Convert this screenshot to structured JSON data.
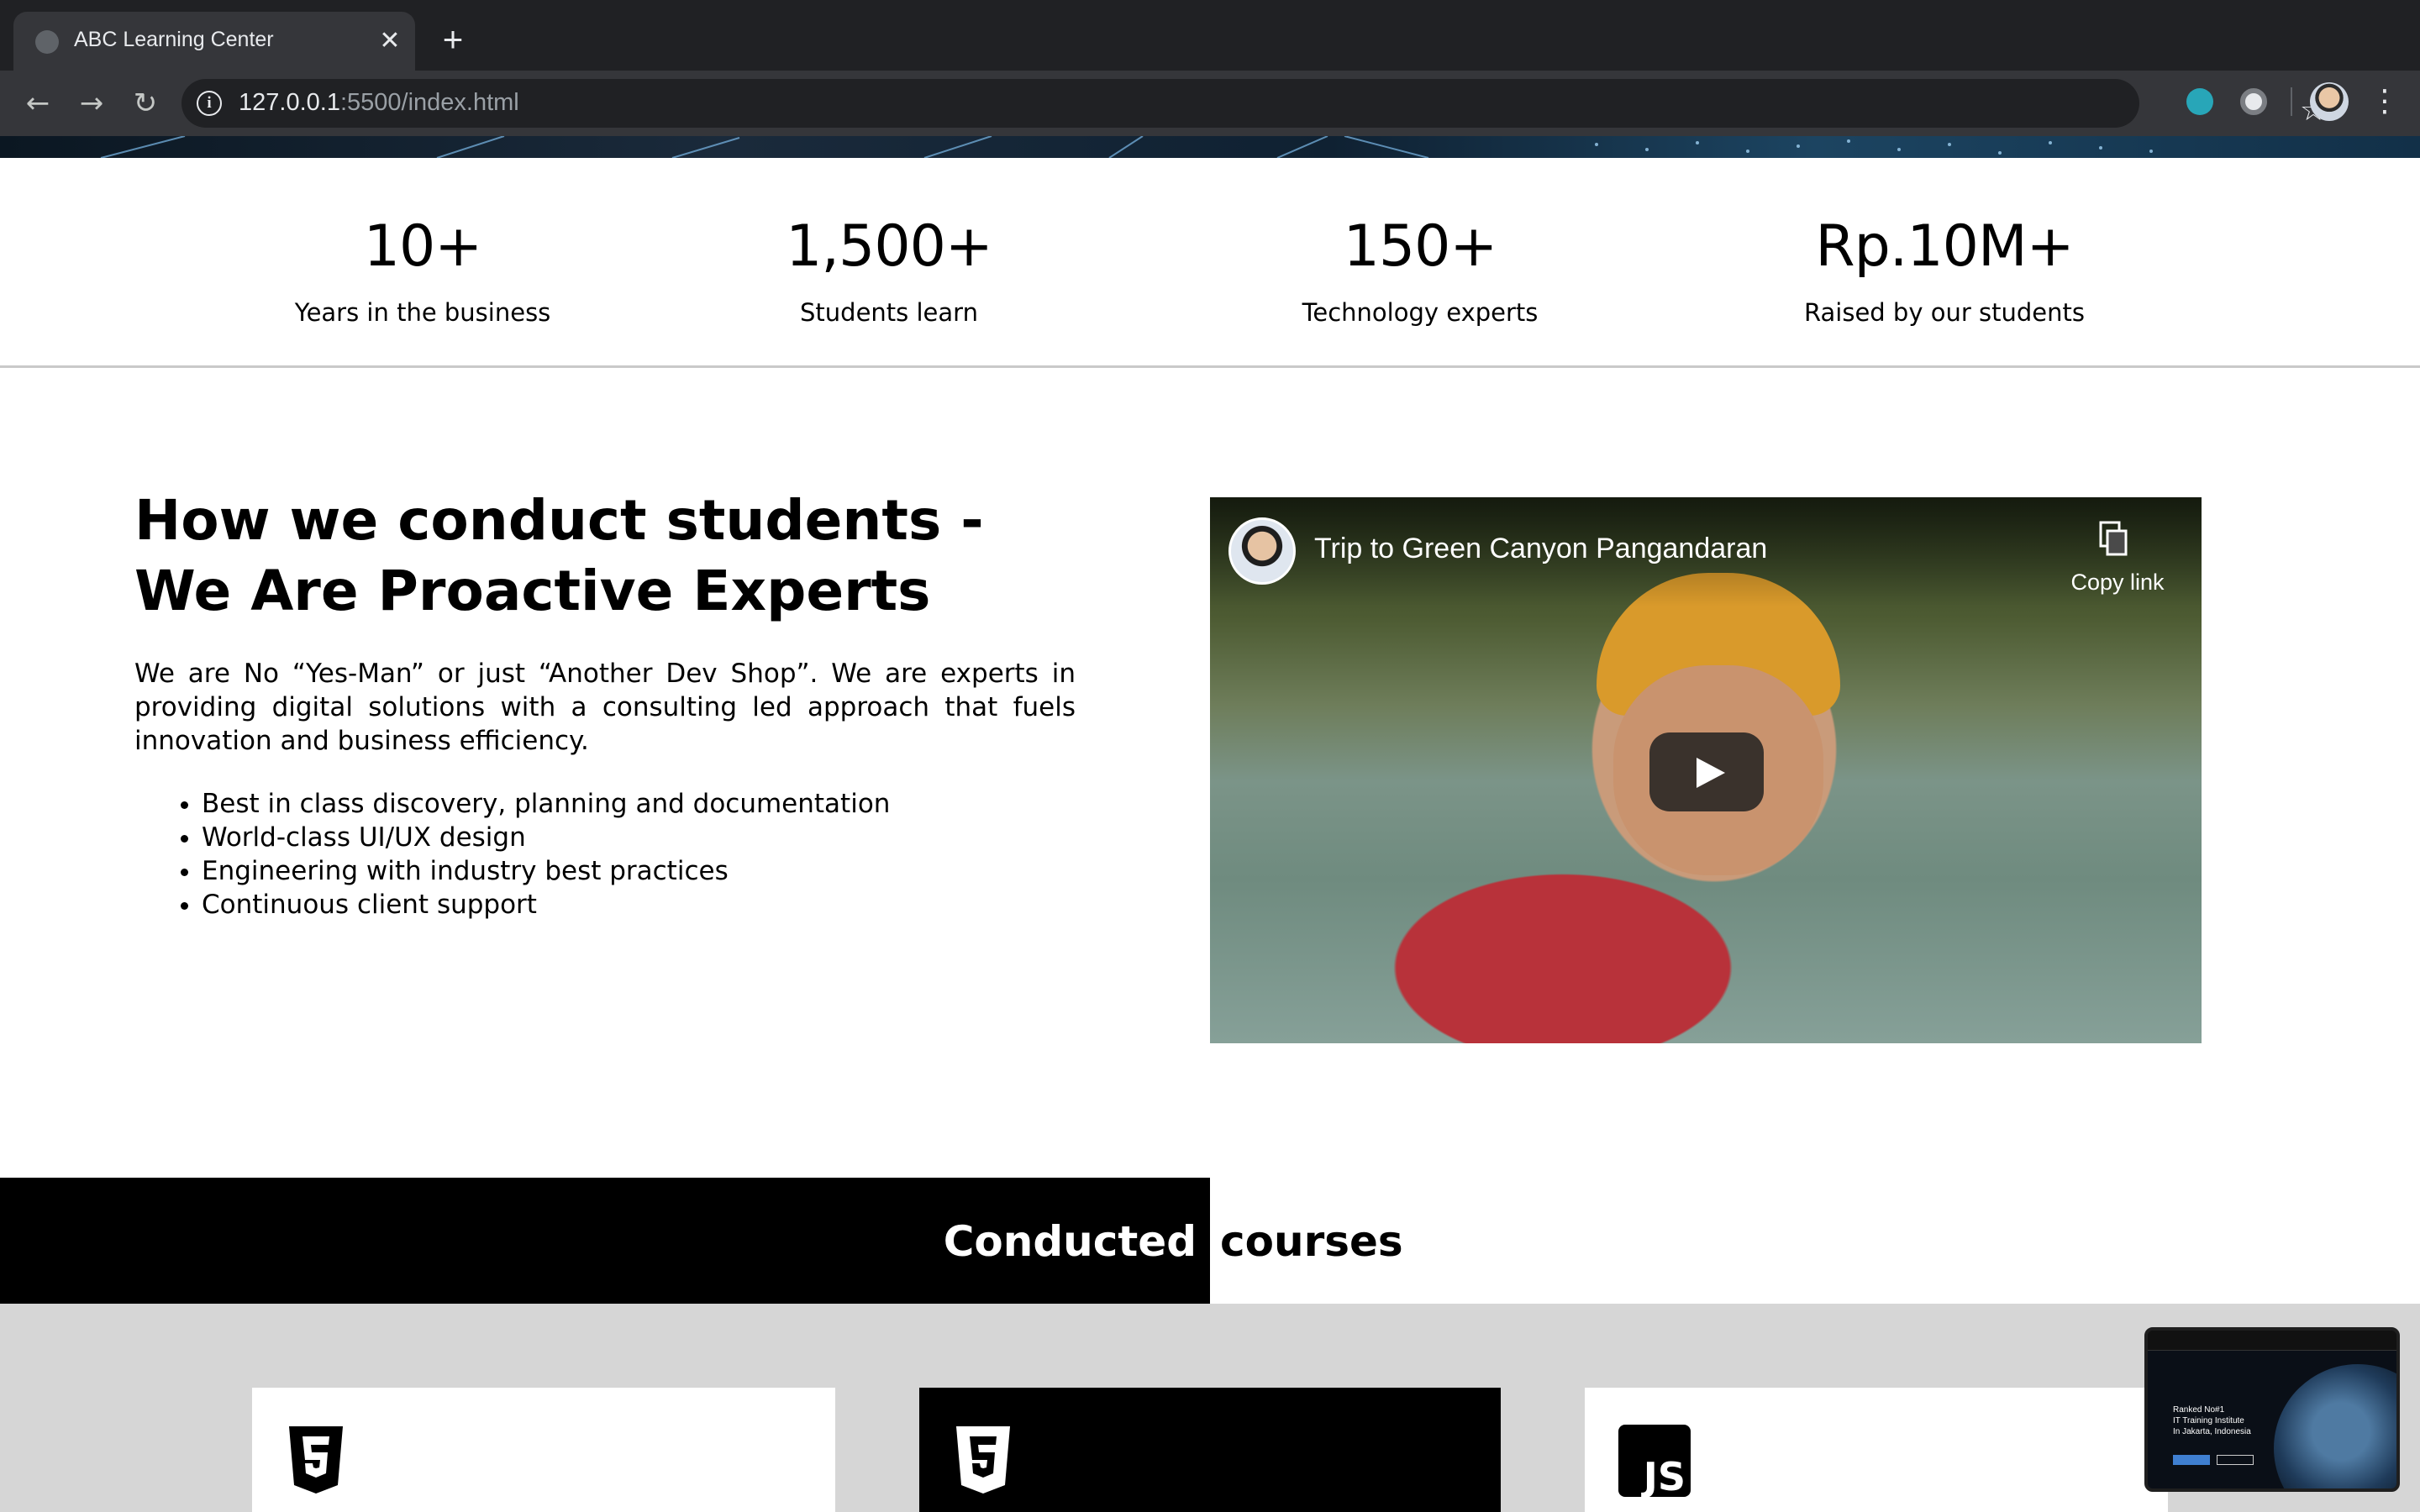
{
  "browser": {
    "tab_title": "ABC Learning Center",
    "tab_close": "✕",
    "new_tab": "+",
    "url_host": "127.0.0.1",
    "url_rest": ":5500/index.html"
  },
  "stats": [
    {
      "value": "10+",
      "label": "Years in the business"
    },
    {
      "value": "1,500+",
      "label": "Students learn"
    },
    {
      "value": "150+",
      "label": "Technology experts"
    },
    {
      "value": "Rp.10M+",
      "label": "Raised by our students"
    }
  ],
  "about": {
    "title": "How we conduct students - We Are Proactive Experts",
    "description": "We are No “Yes-Man” or just “Another Dev Shop”. We are experts in providing digital solutions with a consulting led approach that fuels innovation and business efficiency.",
    "points": [
      "Best in class discovery, planning and documentation",
      "World-class UI/UX design",
      "Engineering with industry best practices",
      "Continuous client support"
    ]
  },
  "video": {
    "title": "Trip to Green Canyon Pangandaran",
    "copy_label": "Copy link"
  },
  "courses": {
    "heading_part1": "Conducted",
    "heading_part2": "courses",
    "cards": [
      {
        "icon": "html5-icon"
      },
      {
        "icon": "css3-icon"
      },
      {
        "icon": "js-icon"
      }
    ]
  },
  "pip": {
    "text": "Ranked No#1\nIT Training Institute\nIn Jakarta, Indonesia"
  },
  "colors": {
    "chrome_dark": "#202124",
    "chrome_toolbar": "#35363a",
    "band_black": "#000000",
    "courses_bg": "#d6d6d6"
  }
}
